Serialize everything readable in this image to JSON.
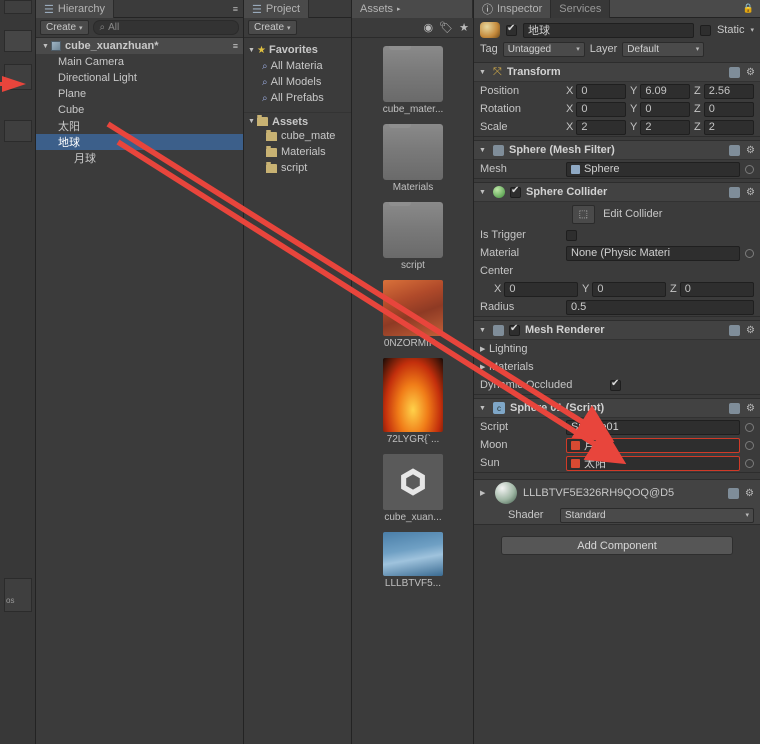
{
  "hierarchy": {
    "tab": "Hierarchy",
    "create_label": "Create",
    "search_placeholder": "All",
    "root": "cube_xuanzhuan*",
    "items": [
      {
        "label": "Main Camera",
        "indent": 1,
        "selected": false
      },
      {
        "label": "Directional Light",
        "indent": 1,
        "selected": false
      },
      {
        "label": "Plane",
        "indent": 1,
        "selected": false
      },
      {
        "label": "Cube",
        "indent": 1,
        "selected": false
      },
      {
        "label": "太阳",
        "indent": 1,
        "selected": false
      },
      {
        "label": "地球",
        "indent": 1,
        "selected": true
      },
      {
        "label": "月球",
        "indent": 2,
        "selected": false
      }
    ]
  },
  "project": {
    "tab": "Project",
    "create_label": "Create",
    "favorites": "Favorites",
    "favorite_items": [
      "All Materia",
      "All Models",
      "All Prefabs"
    ],
    "assets_label": "Assets",
    "tree": [
      "cube_mate",
      "Materials",
      "script"
    ]
  },
  "assets": {
    "breadcrumb": "Assets",
    "items": [
      {
        "label": "cube_mater...",
        "kind": "folder"
      },
      {
        "label": "Materials",
        "kind": "folder"
      },
      {
        "label": "script",
        "kind": "folder"
      },
      {
        "label": "0NZORMIF...",
        "kind": "img-sunset"
      },
      {
        "label": "72LYGR{`...",
        "kind": "img-fire"
      },
      {
        "label": "cube_xuan...",
        "kind": "unity"
      },
      {
        "label": "LLLBTVF5...",
        "kind": "img-earth"
      }
    ]
  },
  "inspector": {
    "tab": "Inspector",
    "services_tab": "Services",
    "object_name": "地球",
    "object_enabled": true,
    "static_label": "Static",
    "tag_label": "Tag",
    "tag_value": "Untagged",
    "layer_label": "Layer",
    "layer_value": "Default",
    "transform": {
      "title": "Transform",
      "rows": [
        {
          "label": "Position",
          "x": "0",
          "y": "6.09",
          "z": "2.56"
        },
        {
          "label": "Rotation",
          "x": "0",
          "y": "0",
          "z": "0"
        },
        {
          "label": "Scale",
          "x": "2",
          "y": "2",
          "z": "2"
        }
      ],
      "axes": [
        "X",
        "Y",
        "Z"
      ]
    },
    "mesh_filter": {
      "title": "Sphere (Mesh Filter)",
      "mesh_label": "Mesh",
      "mesh_value": "Sphere"
    },
    "sphere_collider": {
      "title": "Sphere Collider",
      "enabled": true,
      "edit_collider_label": "Edit Collider",
      "is_trigger_label": "Is Trigger",
      "is_trigger_checked": false,
      "material_label": "Material",
      "material_value": "None (Physic Materi",
      "center_label": "Center",
      "center": {
        "x": "0",
        "y": "0",
        "z": "0"
      },
      "radius_label": "Radius",
      "radius_value": "0.5"
    },
    "mesh_renderer": {
      "title": "Mesh Renderer",
      "enabled": true,
      "lighting_label": "Lighting",
      "materials_label": "Materials",
      "dynamic_occluded_label": "Dynamic Occluded",
      "dynamic_occluded_checked": true
    },
    "script_comp": {
      "title": "Sphere 01 (Script)",
      "script_label": "Script",
      "script_value": "Sphere01",
      "rows": [
        {
          "label": "Moon",
          "value": "月球"
        },
        {
          "label": "Sun",
          "value": "太阳"
        }
      ]
    },
    "material_asset": {
      "name": "LLLBTVF5E326RH9QOQ@D5",
      "shader_label": "Shader",
      "shader_value": "Standard"
    },
    "add_component_label": "Add Component"
  },
  "annotations": {
    "arrow_color": "#e8453c",
    "arrows": [
      {
        "from": [
          110,
          125
        ],
        "to": [
          596,
          430
        ]
      },
      {
        "from": [
          118,
          140
        ],
        "to": [
          608,
          452
        ]
      }
    ]
  }
}
